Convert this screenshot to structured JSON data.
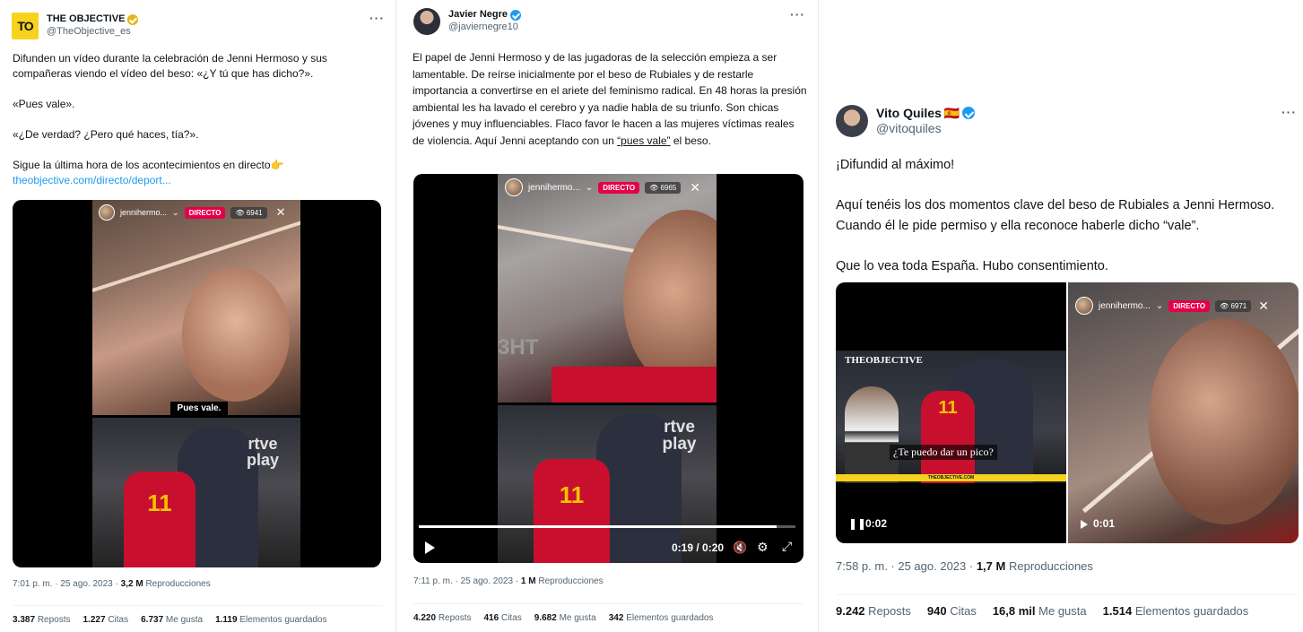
{
  "tweets": [
    {
      "display_name": "THE OBJECTIVE",
      "handle": "@TheObjective_es",
      "avatar_text": "TO",
      "body": "Difunden un vídeo durante la celebración de Jenni Hermoso y sus compañeras viendo el vídeo del beso: «¿Y tú que has dicho?».\n\n«Pues vale».\n\n«¿De verdad? ¿Pero qué haces, tía?».\n\nSigue la última hora de los acontecimientos en directo👉",
      "link": "theobjective.com/directo/deport...",
      "video": {
        "live_user": "jennihermo...",
        "live_label": "DIRECTO",
        "viewers": "6941",
        "caption": "Pues vale.",
        "watermark": "rtve play",
        "jersey": "11"
      },
      "time": "7:01 p. m. · 25 ago. 2023 · ",
      "views": "3,2 M",
      "views_label": "Reproducciones",
      "stats": [
        {
          "value": "3.387",
          "label": "Reposts"
        },
        {
          "value": "1.227",
          "label": "Citas"
        },
        {
          "value": "6.737",
          "label": "Me gusta"
        },
        {
          "value": "1.119",
          "label": "Elementos guardados"
        }
      ]
    },
    {
      "display_name": "Javier Negre",
      "handle": "@javiernegre10",
      "body_before": "El papel de Jenni Hermoso y de las jugadoras de la selección empieza a ser lamentable. De reírse inicialmente por el beso de Rubiales y de restarle importancia a convertirse en el ariete del feminismo radical. En 48 horas la presión ambiental les ha lavado el cerebro y ya nadie habla de su triunfo. Son chicas jóvenes y muy influenciables. Flaco favor le hacen a las mujeres víctimas reales de violencia. Aquí Jenni aceptando con un ",
      "body_quote": "“pues vale”",
      "body_after": " el beso.",
      "video": {
        "live_user": "jennihermo...",
        "live_label": "DIRECTO",
        "viewers": "6965",
        "watermark": "rtve play",
        "jersey": "11",
        "banner": "3HT",
        "time": "0:19 / 0:20",
        "progress": 0.95
      },
      "time": "7:11 p. m. · 25 ago. 2023 · ",
      "views": "1 M",
      "views_label": "Reproducciones",
      "stats": [
        {
          "value": "4.220",
          "label": "Reposts"
        },
        {
          "value": "416",
          "label": "Citas"
        },
        {
          "value": "9.682",
          "label": "Me gusta"
        },
        {
          "value": "342",
          "label": "Elementos guardados"
        }
      ]
    },
    {
      "display_name": "Vito Quiles",
      "handle": "@vitoquiles",
      "flag": "🇪🇸",
      "body": "¡Difundid al máximo!\n\nAquí tenéis los dos momentos clave del beso de Rubiales a Jenni Hermoso. Cuando él le pide permiso y ella reconoce haberle dicho “vale”.\n\nQue lo vea toda España. Hubo consentimiento.",
      "video_left": {
        "logo": "THEOBJECTIVE",
        "subtitle": "¿Te puedo dar un pico?",
        "footer": "THEOBJECTIVE.COM",
        "jersey": "11",
        "duration": "0:02"
      },
      "video_right": {
        "live_user": "jennihermo...",
        "live_label": "DIRECTO",
        "viewers": "6971",
        "duration": "0:01"
      },
      "time": "7:58 p. m. · 25 ago. 2023 · ",
      "views": "1,7 M",
      "views_label": "Reproducciones",
      "stats": [
        {
          "value": "9.242",
          "label": "Reposts"
        },
        {
          "value": "940",
          "label": "Citas"
        },
        {
          "value": "16,8 mil",
          "label": "Me gusta"
        },
        {
          "value": "1.514",
          "label": "Elementos guardados"
        }
      ]
    }
  ],
  "more_label": "···",
  "close_glyph": "✕",
  "eye_glyph": "👁",
  "colors": {
    "link": "#1d9bf0",
    "secondary": "#536471",
    "live": "#e4004b",
    "verified_gold": "#e2b719",
    "verified_blue": "#1d9bf0",
    "jersey_red": "#c8102e"
  }
}
